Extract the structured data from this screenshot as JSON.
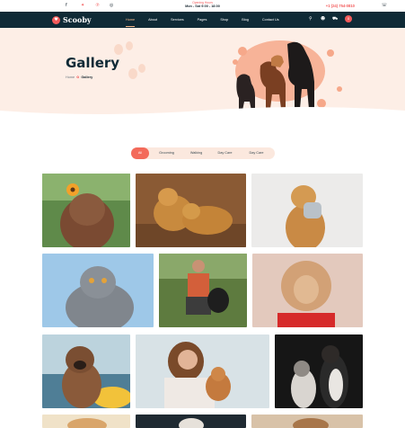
{
  "topbar": {
    "social_icons": [
      "facebook-icon",
      "twitter-icon",
      "pinterest-icon",
      "instagram-icon"
    ],
    "opening_hours_label": "Opening Hours",
    "opening_hours_value": "Mon - Sat 9:00 - 18:00",
    "phone": "+1 (24) 754-0810"
  },
  "nav": {
    "brand": "Scooby",
    "menu": [
      "Home",
      "About",
      "Services",
      "Pages",
      "Shop",
      "Blog",
      "Contact Us"
    ],
    "active_index": 0,
    "cart_count": "0"
  },
  "hero": {
    "title": "Gallery",
    "breadcrumb_home": "Home",
    "breadcrumb_current": "Gallery"
  },
  "filters": {
    "items": [
      "All",
      "Grooming",
      "Walking",
      "Day Care",
      "Day Care"
    ],
    "active_index": 0
  },
  "gallery": {
    "images": [
      "puppy-with-flower",
      "two-golden-retrievers-lying",
      "golden-retriever-with-toy",
      "grey-cat",
      "man-with-dog-on-grass",
      "fluffy-dog-red-scarf",
      "french-bulldog-by-sea",
      "woman-with-puppy",
      "cat-and-dog-on-dark-background"
    ]
  },
  "colors": {
    "accent": "#f35b5b",
    "nav_bg": "#0f2a36",
    "hero_bg": "#fdeee6"
  }
}
